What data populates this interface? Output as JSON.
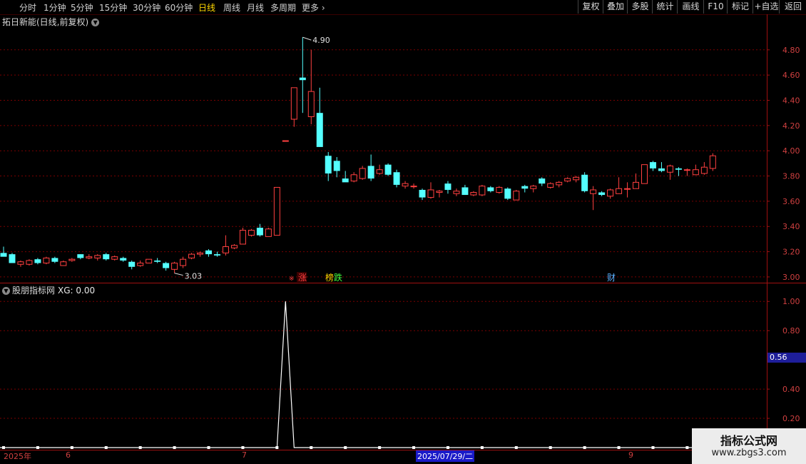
{
  "toolbar": {
    "timeframes": [
      "分时",
      "1分钟",
      "5分钟",
      "15分钟",
      "30分钟",
      "60分钟",
      "日线",
      "周线",
      "月线",
      "多周期",
      "更多"
    ],
    "active_timeframe": "日线",
    "right_buttons": [
      "复权",
      "叠加",
      "多股",
      "统计",
      "画线",
      "F10",
      "标记",
      "+自选",
      "返回"
    ]
  },
  "main_chart": {
    "title": "拓日新能(日线,前复权)",
    "y_ticks": [
      "4.80",
      "4.60",
      "4.40",
      "4.20",
      "4.00",
      "3.80",
      "3.60",
      "3.40",
      "3.20",
      "3.00"
    ],
    "high_label": "4.90",
    "low_label": "3.03",
    "markers": [
      {
        "text": "涨",
        "color": "#ff4040"
      },
      {
        "text": "榜",
        "color": "#ffd700"
      },
      {
        "text": "跌",
        "color": "#40ff40"
      },
      {
        "text": "财",
        "color": "#5ab0ff"
      }
    ]
  },
  "sub_chart": {
    "title": "股朋指标网",
    "xg_label": "XG: 0.00",
    "y_ticks": [
      "1.00",
      "0.80",
      "0.40",
      "0.20"
    ],
    "current_value": "0.56"
  },
  "date_axis": [
    "2025年",
    "6",
    "7",
    "2025/07/29/二",
    "9"
  ],
  "watermark": {
    "title": "指标公式网",
    "url": "www.zbgs3.com"
  },
  "colors": {
    "up": "#ff4040",
    "down": "#54ffff",
    "grid": "#7a0000",
    "axis": "#a01010"
  },
  "chart_data": {
    "type": "candlestick",
    "ylim": [
      2.96,
      4.98
    ],
    "candles": [
      {
        "o": 3.19,
        "h": 3.24,
        "l": 3.17,
        "c": 3.16
      },
      {
        "o": 3.18,
        "h": 3.19,
        "l": 3.11,
        "c": 3.11
      },
      {
        "o": 3.1,
        "h": 3.13,
        "l": 3.08,
        "c": 3.12
      },
      {
        "o": 3.1,
        "h": 3.14,
        "l": 3.09,
        "c": 3.13
      },
      {
        "o": 3.14,
        "h": 3.15,
        "l": 3.1,
        "c": 3.11
      },
      {
        "o": 3.11,
        "h": 3.16,
        "l": 3.1,
        "c": 3.15
      },
      {
        "o": 3.15,
        "h": 3.16,
        "l": 3.11,
        "c": 3.12
      },
      {
        "o": 3.09,
        "h": 3.13,
        "l": 3.09,
        "c": 3.12
      },
      {
        "o": 3.13,
        "h": 3.15,
        "l": 3.12,
        "c": 3.14
      },
      {
        "o": 3.18,
        "h": 3.18,
        "l": 3.14,
        "c": 3.15
      },
      {
        "o": 3.15,
        "h": 3.18,
        "l": 3.14,
        "c": 3.16
      },
      {
        "o": 3.15,
        "h": 3.18,
        "l": 3.13,
        "c": 3.17
      },
      {
        "o": 3.18,
        "h": 3.19,
        "l": 3.13,
        "c": 3.14
      },
      {
        "o": 3.14,
        "h": 3.17,
        "l": 3.13,
        "c": 3.16
      },
      {
        "o": 3.15,
        "h": 3.16,
        "l": 3.12,
        "c": 3.13
      },
      {
        "o": 3.12,
        "h": 3.13,
        "l": 3.06,
        "c": 3.08
      },
      {
        "o": 3.09,
        "h": 3.13,
        "l": 3.08,
        "c": 3.11
      },
      {
        "o": 3.11,
        "h": 3.14,
        "l": 3.11,
        "c": 3.14
      },
      {
        "o": 3.13,
        "h": 3.15,
        "l": 3.11,
        "c": 3.12
      },
      {
        "o": 3.11,
        "h": 3.12,
        "l": 3.05,
        "c": 3.07
      },
      {
        "o": 3.06,
        "h": 3.12,
        "l": 3.03,
        "c": 3.11
      },
      {
        "o": 3.09,
        "h": 3.16,
        "l": 3.07,
        "c": 3.14
      },
      {
        "o": 3.15,
        "h": 3.19,
        "l": 3.14,
        "c": 3.18
      },
      {
        "o": 3.18,
        "h": 3.2,
        "l": 3.16,
        "c": 3.19
      },
      {
        "o": 3.21,
        "h": 3.22,
        "l": 3.16,
        "c": 3.18
      },
      {
        "o": 3.18,
        "h": 3.2,
        "l": 3.16,
        "c": 3.17
      },
      {
        "o": 3.19,
        "h": 3.33,
        "l": 3.17,
        "c": 3.24
      },
      {
        "o": 3.23,
        "h": 3.26,
        "l": 3.22,
        "c": 3.25
      },
      {
        "o": 3.26,
        "h": 3.39,
        "l": 3.26,
        "c": 3.37
      },
      {
        "o": 3.33,
        "h": 3.38,
        "l": 3.32,
        "c": 3.37
      },
      {
        "o": 3.39,
        "h": 3.42,
        "l": 3.32,
        "c": 3.33
      },
      {
        "o": 3.32,
        "h": 3.39,
        "l": 3.32,
        "c": 3.38
      },
      {
        "o": 3.33,
        "h": 3.71,
        "l": 3.33,
        "c": 3.71
      },
      {
        "o": 4.08,
        "h": 4.08,
        "l": 4.08,
        "c": 4.08
      },
      {
        "o": 4.25,
        "h": 4.5,
        "l": 4.19,
        "c": 4.5
      },
      {
        "o": 4.58,
        "h": 4.9,
        "l": 4.3,
        "c": 4.56
      },
      {
        "o": 4.27,
        "h": 4.8,
        "l": 4.21,
        "c": 4.47
      },
      {
        "o": 4.3,
        "h": 4.5,
        "l": 4.03,
        "c": 4.03
      },
      {
        "o": 3.96,
        "h": 3.99,
        "l": 3.76,
        "c": 3.82
      },
      {
        "o": 3.92,
        "h": 3.95,
        "l": 3.79,
        "c": 3.84
      },
      {
        "o": 3.78,
        "h": 3.84,
        "l": 3.76,
        "c": 3.75
      },
      {
        "o": 3.76,
        "h": 3.83,
        "l": 3.75,
        "c": 3.81
      },
      {
        "o": 3.78,
        "h": 3.88,
        "l": 3.77,
        "c": 3.86
      },
      {
        "o": 3.88,
        "h": 3.97,
        "l": 3.76,
        "c": 3.78
      },
      {
        "o": 3.82,
        "h": 3.89,
        "l": 3.81,
        "c": 3.85
      },
      {
        "o": 3.89,
        "h": 3.9,
        "l": 3.8,
        "c": 3.81
      },
      {
        "o": 3.83,
        "h": 3.85,
        "l": 3.71,
        "c": 3.73
      },
      {
        "o": 3.72,
        "h": 3.76,
        "l": 3.7,
        "c": 3.74
      },
      {
        "o": 3.72,
        "h": 3.74,
        "l": 3.7,
        "c": 3.72
      },
      {
        "o": 3.69,
        "h": 3.7,
        "l": 3.61,
        "c": 3.63
      },
      {
        "o": 3.63,
        "h": 3.75,
        "l": 3.62,
        "c": 3.69
      },
      {
        "o": 3.67,
        "h": 3.69,
        "l": 3.63,
        "c": 3.68
      },
      {
        "o": 3.74,
        "h": 3.76,
        "l": 3.66,
        "c": 3.69
      },
      {
        "o": 3.66,
        "h": 3.7,
        "l": 3.64,
        "c": 3.68
      },
      {
        "o": 3.71,
        "h": 3.73,
        "l": 3.65,
        "c": 3.65
      },
      {
        "o": 3.65,
        "h": 3.68,
        "l": 3.64,
        "c": 3.67
      },
      {
        "o": 3.65,
        "h": 3.73,
        "l": 3.64,
        "c": 3.72
      },
      {
        "o": 3.71,
        "h": 3.72,
        "l": 3.67,
        "c": 3.68
      },
      {
        "o": 3.67,
        "h": 3.72,
        "l": 3.66,
        "c": 3.71
      },
      {
        "o": 3.7,
        "h": 3.71,
        "l": 3.61,
        "c": 3.62
      },
      {
        "o": 3.61,
        "h": 3.69,
        "l": 3.61,
        "c": 3.68
      },
      {
        "o": 3.72,
        "h": 3.73,
        "l": 3.67,
        "c": 3.7
      },
      {
        "o": 3.7,
        "h": 3.73,
        "l": 3.67,
        "c": 3.72
      },
      {
        "o": 3.78,
        "h": 3.79,
        "l": 3.72,
        "c": 3.74
      },
      {
        "o": 3.71,
        "h": 3.75,
        "l": 3.7,
        "c": 3.74
      },
      {
        "o": 3.73,
        "h": 3.76,
        "l": 3.71,
        "c": 3.75
      },
      {
        "o": 3.76,
        "h": 3.79,
        "l": 3.75,
        "c": 3.78
      },
      {
        "o": 3.77,
        "h": 3.8,
        "l": 3.75,
        "c": 3.79
      },
      {
        "o": 3.81,
        "h": 3.83,
        "l": 3.67,
        "c": 3.68
      },
      {
        "o": 3.66,
        "h": 3.72,
        "l": 3.53,
        "c": 3.69
      },
      {
        "o": 3.67,
        "h": 3.68,
        "l": 3.64,
        "c": 3.65
      },
      {
        "o": 3.64,
        "h": 3.7,
        "l": 3.62,
        "c": 3.69
      },
      {
        "o": 3.66,
        "h": 3.79,
        "l": 3.66,
        "c": 3.7
      },
      {
        "o": 3.7,
        "h": 3.75,
        "l": 3.63,
        "c": 3.7
      },
      {
        "o": 3.7,
        "h": 3.82,
        "l": 3.7,
        "c": 3.75
      },
      {
        "o": 3.74,
        "h": 3.89,
        "l": 3.74,
        "c": 3.89
      },
      {
        "o": 3.91,
        "h": 3.92,
        "l": 3.84,
        "c": 3.86
      },
      {
        "o": 3.86,
        "h": 3.91,
        "l": 3.83,
        "c": 3.84
      },
      {
        "o": 3.83,
        "h": 3.89,
        "l": 3.77,
        "c": 3.88
      },
      {
        "o": 3.86,
        "h": 3.87,
        "l": 3.8,
        "c": 3.85
      },
      {
        "o": 3.85,
        "h": 3.86,
        "l": 3.8,
        "c": 3.85
      },
      {
        "o": 3.81,
        "h": 3.89,
        "l": 3.81,
        "c": 3.85
      },
      {
        "o": 3.82,
        "h": 3.91,
        "l": 3.81,
        "c": 3.87
      },
      {
        "o": 3.86,
        "h": 3.98,
        "l": 3.84,
        "c": 3.96
      }
    ],
    "indicator": {
      "name": "XG",
      "spike_index": 33,
      "spike_value": 1.0,
      "ylim": [
        0,
        1.05
      ]
    }
  }
}
